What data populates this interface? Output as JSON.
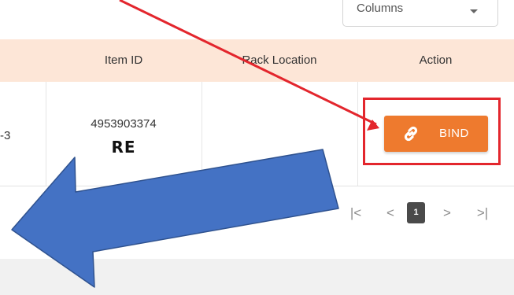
{
  "toolbar": {
    "columns_label": "Columns",
    "columns_icon": "chevron-down-icon"
  },
  "table": {
    "headers": [
      "Item ID",
      "Rack Location",
      "Action"
    ],
    "row": {
      "partial_cell": "-3",
      "item_id": "4953903374",
      "item_badge": "RE",
      "rack_location": "",
      "action_label": "BIND",
      "action_icon": "link-icon"
    }
  },
  "pagination": {
    "first_icon": "first-page-icon",
    "prev_icon": "chevron-left-icon",
    "current_page": "1",
    "next_icon": "chevron-right-icon",
    "last_icon": "last-page-icon"
  },
  "colors": {
    "header_bg": "#fde6d7",
    "bind_button": "#ee7a2e",
    "highlight_box": "#e3262d",
    "annotation_arrow_red": "#e3262d",
    "annotation_arrow_blue": "#4472c4"
  }
}
